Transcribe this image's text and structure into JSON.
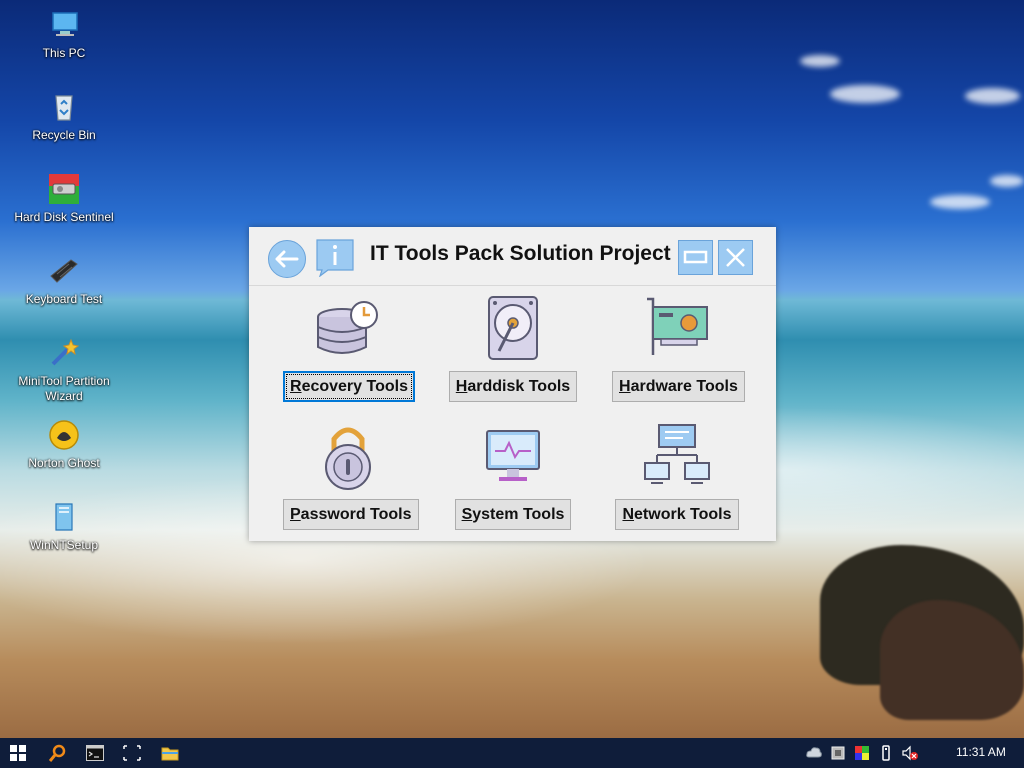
{
  "desktop": {
    "icons": [
      {
        "label": "This PC"
      },
      {
        "label": "Recycle Bin"
      },
      {
        "label": "Hard Disk Sentinel"
      },
      {
        "label": "Keyboard Test"
      },
      {
        "label": "MiniTool Partition\nWizard"
      },
      {
        "label": "Norton Ghost"
      },
      {
        "label": "WinNTSetup"
      }
    ]
  },
  "window": {
    "title": "IT Tools Pack Solution Project",
    "tools": [
      {
        "pre": "",
        "key": "R",
        "rest": "ecovery Tools"
      },
      {
        "pre": "",
        "key": "H",
        "rest": "arddisk Tools"
      },
      {
        "pre": "",
        "key": "H",
        "rest": "ardware Tools"
      },
      {
        "pre": "",
        "key": "P",
        "rest": "assword Tools"
      },
      {
        "pre": "",
        "key": "S",
        "rest": "ystem Tools"
      },
      {
        "pre": "",
        "key": "N",
        "rest": "etwork Tools"
      }
    ],
    "icons": [
      "database-clock-icon",
      "harddisk-icon",
      "hardware-card-icon",
      "padlock-icon",
      "monitor-icon",
      "network-icon"
    ]
  },
  "taskbar": {
    "clock": "11:31 AM",
    "icons": [
      "windows-start-icon",
      "search-icon",
      "command-prompt-icon",
      "task-view-icon",
      "file-explorer-icon"
    ],
    "tray": [
      "cloud-icon",
      "hardware-icon",
      "display-color-icon",
      "usb-icon",
      "volume-muted-icon"
    ]
  },
  "colors": {
    "accent": "#9ccaf2",
    "accent_border": "#6aa3da",
    "focus": "#0078d7",
    "taskbar": "#0f1d3a"
  }
}
